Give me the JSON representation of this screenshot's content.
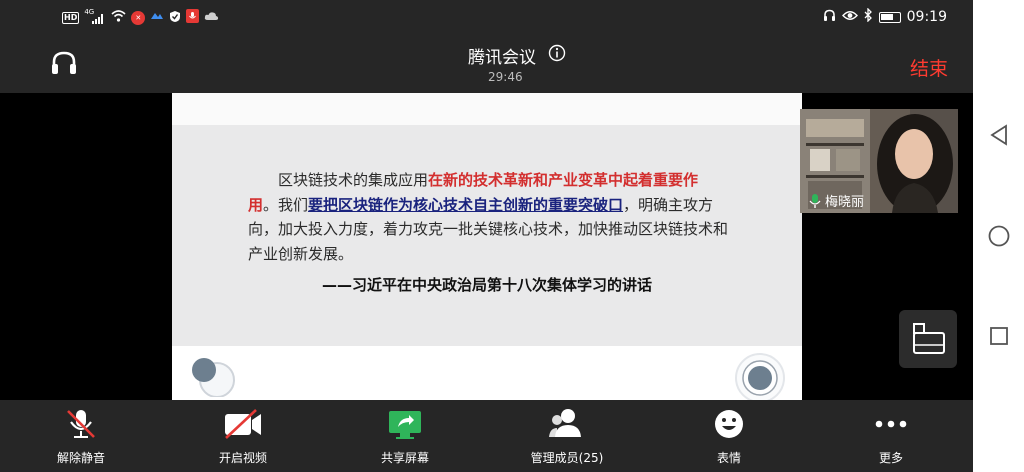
{
  "status_bar": {
    "left_icons": [
      "hd-icon",
      "signal-4g-icon",
      "wifi-icon",
      "app-notification-icon",
      "cloud-service-icon",
      "shield-icon",
      "mic-recording-icon",
      "cloud-icon"
    ],
    "hd_label": "HD",
    "network_label": "4G",
    "right_icons": [
      "headset-icon",
      "eye-icon",
      "bluetooth-icon",
      "battery-icon"
    ],
    "time": "09:19"
  },
  "header": {
    "title": "腾讯会议",
    "duration": "29:46",
    "end_label": "结束",
    "end_color": "#ff3b30"
  },
  "shared_screen": {
    "paragraph_plain_1": "区块链技术的集成应用",
    "paragraph_red": "在新的技术革新和产业变革中起着重要作用",
    "paragraph_plain_2": "。我们",
    "paragraph_blue": "要把区块链作为核心技术自主创新的重要突破口",
    "paragraph_plain_3": "，明确主攻方向，加大投入力度，着力攻克一批关键核心技术，加快推动区块链技术和产业创新发展。",
    "quote": "——习近平在中央政治局第十八次集体学习的讲话",
    "red_color": "#d32f2f",
    "blue_color": "#1a237e"
  },
  "participant_video": {
    "name": "梅晓丽"
  },
  "toolbar": {
    "items": [
      {
        "label": "解除静音",
        "icon": "mic-muted-icon"
      },
      {
        "label": "开启视频",
        "icon": "camera-off-icon"
      },
      {
        "label": "共享屏幕",
        "icon": "share-screen-icon",
        "accent": "#2fb55a"
      },
      {
        "label": "管理成员(25)",
        "icon": "members-icon"
      },
      {
        "label": "表情",
        "icon": "emoji-icon"
      },
      {
        "label": "更多",
        "icon": "more-icon"
      }
    ]
  },
  "nav_bar": {
    "items": [
      "back-icon",
      "home-icon",
      "recents-icon"
    ]
  }
}
